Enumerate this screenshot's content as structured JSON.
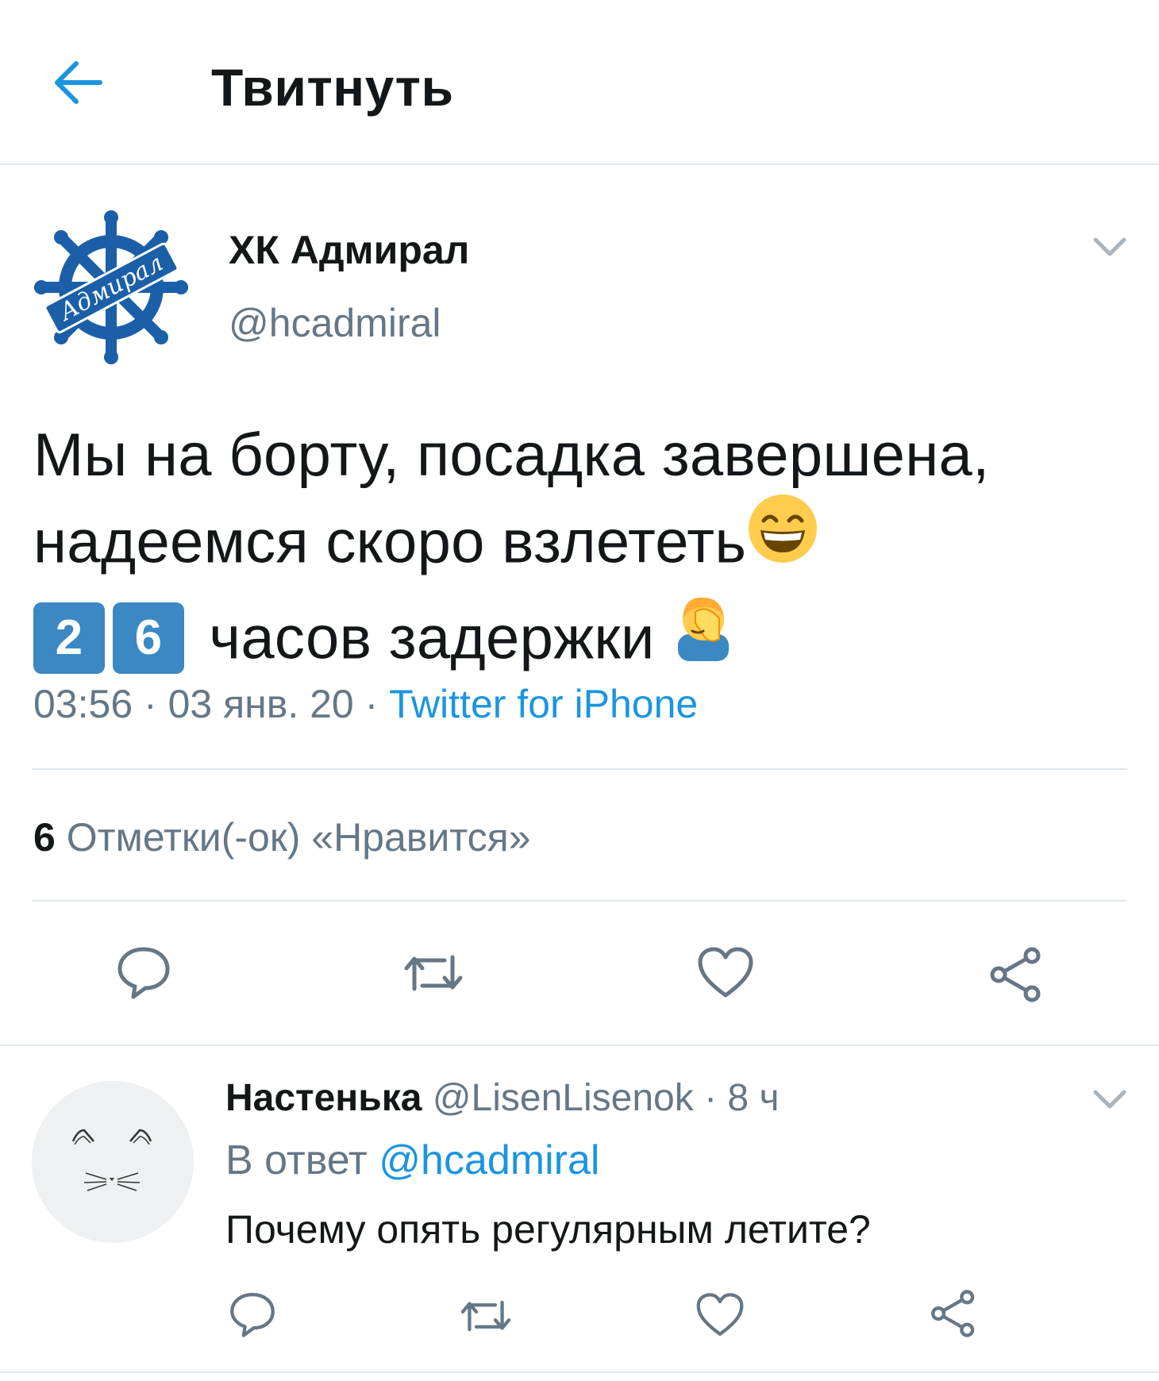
{
  "header": {
    "title": "Твитнуть"
  },
  "tweet": {
    "author_name": "ХК Адмирал",
    "author_handle": "@hcadmiral",
    "avatar_text": "Адмирал",
    "text_line1": "Мы на борту, посадка завершена,",
    "text_line2": "надеемся скоро взлететь",
    "keycap_1": "2",
    "keycap_2": "6",
    "text_line3": "часов задержки",
    "time": "03:56",
    "date": "03 янв. 20",
    "source": "Twitter for iPhone",
    "likes_count": "6",
    "likes_label": "Отметки(-ок) «Нравится»"
  },
  "reply": {
    "author_name": "Настенька",
    "author_handle": "@LisenLisenok",
    "age": "8 ч",
    "reply_prefix": "В ответ",
    "reply_to": "@hcadmiral",
    "text": "Почему опять регулярным летите?"
  },
  "icons": {
    "back": "arrow-left-icon",
    "caret": "chevron-down-icon",
    "reply": "speech-bubble-icon",
    "retweet": "retweet-icon",
    "like": "heart-icon",
    "share": "share-icon",
    "emoji_grin": "grinning-face-emoji",
    "emoji_facepalm": "facepalm-emoji"
  },
  "colors": {
    "accent": "#1b95e0",
    "secondary_text": "#657786",
    "divider": "#e1e8ed",
    "logo_blue": "#1a5fa8"
  }
}
